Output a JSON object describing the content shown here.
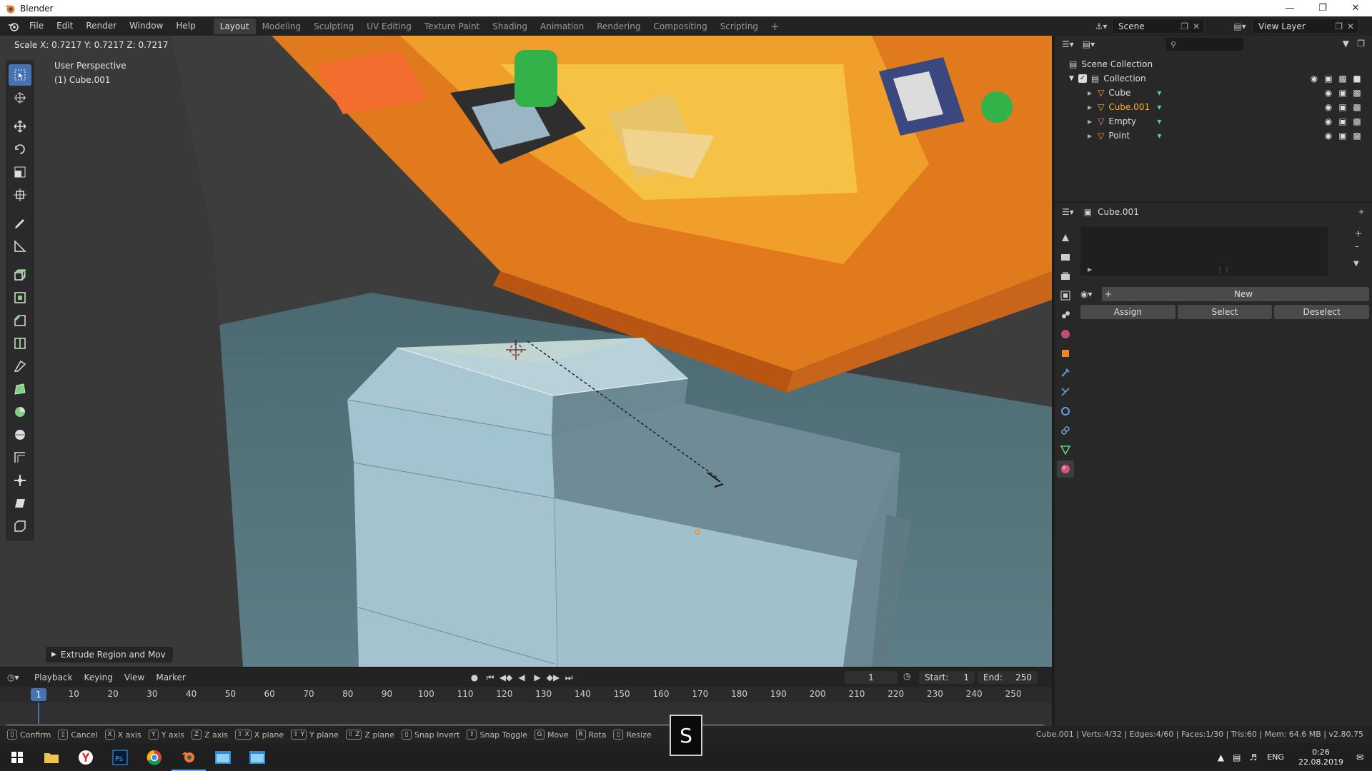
{
  "window": {
    "title": "Blender"
  },
  "menu": [
    "File",
    "Edit",
    "Render",
    "Window",
    "Help"
  ],
  "workspaces": [
    "Layout",
    "Modeling",
    "Sculpting",
    "UV Editing",
    "Texture Paint",
    "Shading",
    "Animation",
    "Rendering",
    "Compositing",
    "Scripting"
  ],
  "scene": {
    "name": "Scene",
    "view_layer": "View Layer"
  },
  "viewport": {
    "status": "Scale X: 0.7217  Y: 0.7217  Z: 0.7217",
    "perspective": "User Perspective",
    "object": "(1) Cube.001",
    "operator_panel": "Extrude Region and Mov"
  },
  "timeline": {
    "menu": [
      "Playback",
      "Keying",
      "View",
      "Marker"
    ],
    "current_frame": "1",
    "start_label": "Start:",
    "start": "1",
    "end_label": "End:",
    "end": "250",
    "ticks": [
      "1",
      "10",
      "20",
      "30",
      "40",
      "50",
      "60",
      "70",
      "80",
      "90",
      "100",
      "110",
      "120",
      "130",
      "140",
      "150",
      "160",
      "170",
      "180",
      "190",
      "200",
      "210",
      "220",
      "230",
      "240",
      "250"
    ]
  },
  "statusbar": {
    "items": [
      {
        "key": "",
        "label": "Confirm"
      },
      {
        "key": "",
        "label": "Cancel"
      },
      {
        "key": "X",
        "label": "X axis"
      },
      {
        "key": "Y",
        "label": "Y axis"
      },
      {
        "key": "Z",
        "label": "Z axis"
      },
      {
        "key": "⇧ X",
        "label": "X plane"
      },
      {
        "key": "⇧ Y",
        "label": "Y plane"
      },
      {
        "key": "⇧ Z",
        "label": "Z plane"
      },
      {
        "key": "",
        "label": "Snap Invert"
      },
      {
        "key": "⇧",
        "label": "Snap Toggle"
      },
      {
        "key": "G",
        "label": "Move"
      },
      {
        "key": "R",
        "label": "Rota"
      },
      {
        "key": "",
        "label": "Resize"
      }
    ],
    "stats": "Cube.001 | Verts:4/32 | Edges:4/60 | Faces:1/30 | Tris:60 | Mem: 64.6 MB | v2.80.75",
    "key_overlay": "S"
  },
  "outliner": {
    "root": "Scene Collection",
    "collection": "Collection",
    "items": [
      {
        "name": "Cube",
        "color": "#ff9f40"
      },
      {
        "name": "Cube.001",
        "color": "#ffaf29"
      },
      {
        "name": "Empty",
        "color": "#e08aa8"
      },
      {
        "name": "Point",
        "color": "#ff9f40"
      }
    ]
  },
  "properties": {
    "object": "Cube.001",
    "new_label": "New",
    "assign_label": "Assign",
    "select_label": "Select",
    "deselect_label": "Deselect"
  },
  "taskbar": {
    "lang": "ENG",
    "time": "0:26",
    "date": "22.08.2019"
  },
  "colors": {
    "accent": "#4772b3",
    "selected_orange": "#ffaf29",
    "viewport_bg": "#4f6c72"
  }
}
